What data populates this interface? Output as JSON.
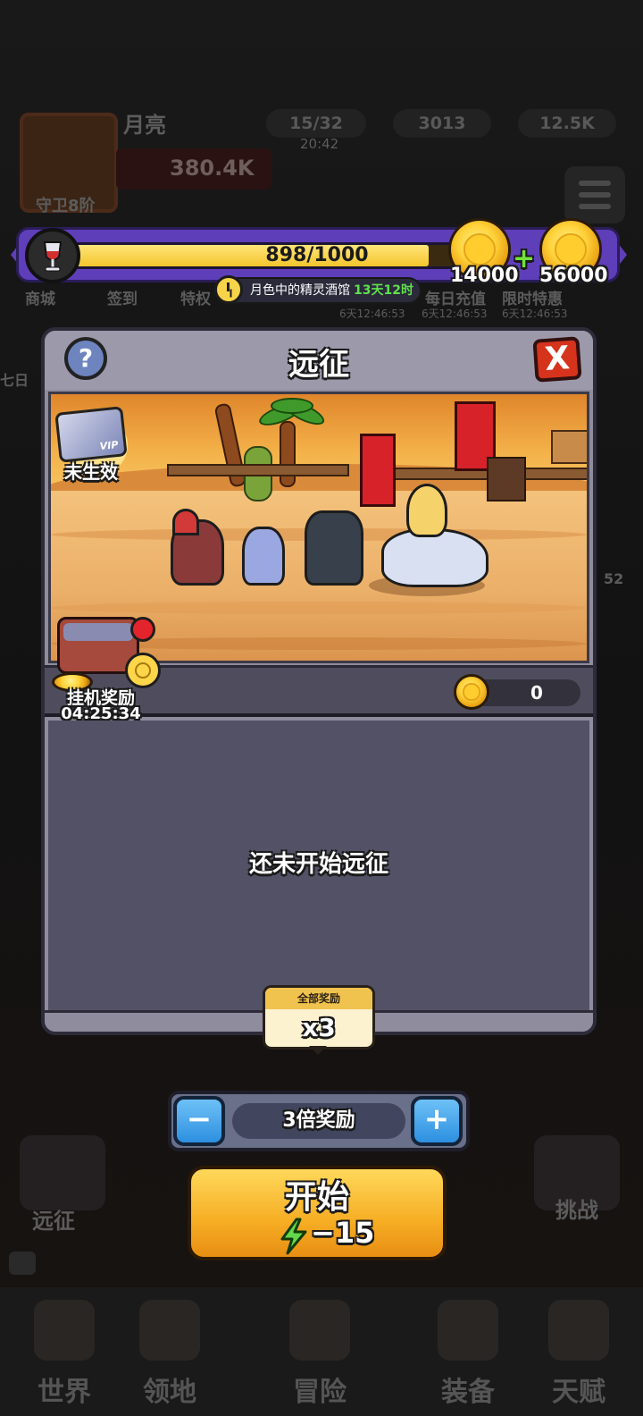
{
  "background": {
    "player_name": "月亮",
    "player_rank": "守卫8阶",
    "power": "380.4K",
    "energy": "15/32",
    "energy_timer": "20:42",
    "resource_2": "3013",
    "resource_3": "12.5K",
    "menu_row": [
      "商城",
      "签到",
      "特权",
      "每日充值",
      "限时特惠"
    ],
    "menu_timers": [
      "6天12:46:53",
      "6天12:46:53",
      "6天12:46:53"
    ],
    "side_left_label": "七日",
    "side_right_timer": "52",
    "side_left_bottom": "远征",
    "side_right_bottom": "挑战",
    "bottom_nav": [
      "世界",
      "领地",
      "冒险",
      "装备",
      "天赋"
    ]
  },
  "topbar": {
    "progress_text": "898/1000",
    "progress_value": 0.898,
    "coin_left": "14000",
    "coin_right": "56000",
    "event_name": "月色中的精灵酒馆",
    "event_time": "13天12时"
  },
  "panel": {
    "title": "远征",
    "help_symbol": "?",
    "close_symbol": "X",
    "vip_status": "未生效",
    "idle_reward_label": "挂机奖励",
    "idle_timer": "04:25:34",
    "gold_amount": "0",
    "empty_message": "还未开始远征"
  },
  "tooltip": {
    "header": "全部奖励",
    "value": "x3"
  },
  "stepper": {
    "minus": "−",
    "plus": "+",
    "label": "3倍奖励"
  },
  "start": {
    "label": "开始",
    "cost": "−15"
  },
  "colors": {
    "topbar": "#5f3eb9",
    "progress": "#f4c52c",
    "panel": "#8f8c9e",
    "start_button": "#f6ad23",
    "stepper_button": "#2d8fe0"
  }
}
